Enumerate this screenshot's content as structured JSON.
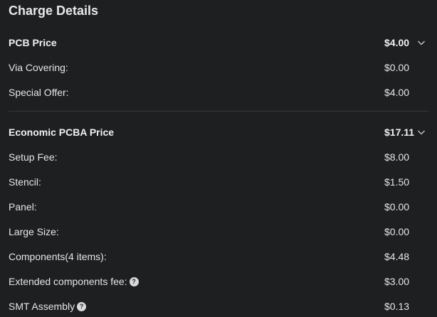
{
  "title": "Charge Details",
  "pcb": {
    "label": "PCB Price",
    "value": "$4.00",
    "items": [
      {
        "label": "Via Covering:",
        "value": "$0.00"
      },
      {
        "label": "Special Offer:",
        "value": "$4.00"
      }
    ]
  },
  "pcba": {
    "label": "Economic PCBA Price",
    "value": "$17.11",
    "items": [
      {
        "label": "Setup Fee:",
        "value": "$8.00"
      },
      {
        "label": "Stencil:",
        "value": "$1.50"
      },
      {
        "label": "Panel:",
        "value": "$0.00"
      },
      {
        "label": "Large Size:",
        "value": "$0.00"
      },
      {
        "label": "Components(4 items):",
        "value": "$4.48"
      },
      {
        "label": "Extended components fee:",
        "value": "$3.00",
        "help_icon": "question-icon"
      },
      {
        "label": "SMT Assembly",
        "value": "$0.13",
        "help_icon": "question-icon"
      }
    ]
  },
  "icons": {
    "expand": "chevron-down-icon",
    "help": "question-icon",
    "help_glyph": "?"
  }
}
